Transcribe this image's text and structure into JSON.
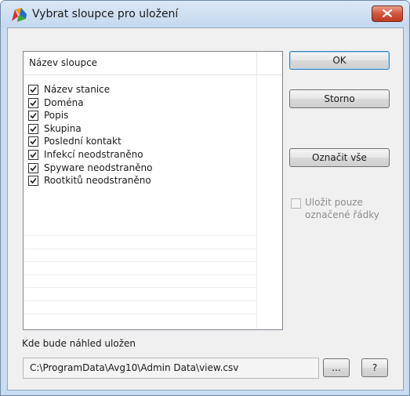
{
  "window": {
    "title": "Vybrat sloupce pro uložení"
  },
  "list": {
    "header": "Název sloupce",
    "items": [
      {
        "label": "Název stanice",
        "checked": true
      },
      {
        "label": "Doména",
        "checked": true
      },
      {
        "label": "Popis",
        "checked": true
      },
      {
        "label": "Skupina",
        "checked": true
      },
      {
        "label": "Poslední kontakt",
        "checked": true
      },
      {
        "label": "Infekcí neodstraněno",
        "checked": true
      },
      {
        "label": "Spyware neodstraněno",
        "checked": true
      },
      {
        "label": "Rootkitů neodstraněno",
        "checked": true
      }
    ]
  },
  "buttons": {
    "ok": "OK",
    "cancel": "Storno",
    "select_all": "Označit vše",
    "browse": "...",
    "help": "?"
  },
  "save_checked_only": {
    "line1": "Uložit pouze",
    "line2": "označené řádky",
    "checked": false,
    "enabled": false
  },
  "path": {
    "label": "Kde bude náhled uložen",
    "value": "C:\\ProgramData\\Avg10\\Admin Data\\view.csv"
  },
  "colors": {
    "title_bar": "#c4d8ee",
    "close_button": "#c9472e",
    "default_button_border": "#3c7fb1",
    "dialog_background": "#f0f0f0"
  }
}
